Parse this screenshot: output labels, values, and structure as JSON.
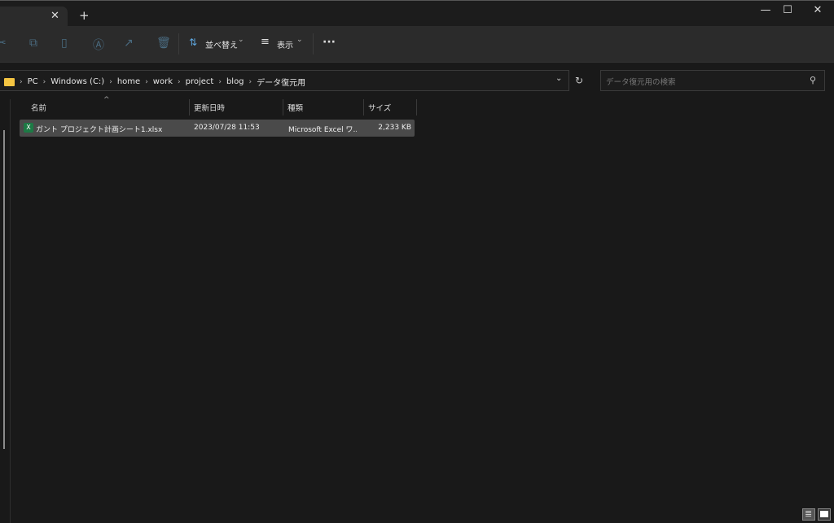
{
  "tabs": {
    "close": "✕",
    "new": "+"
  },
  "window": {
    "minimize": "—",
    "maximize": "☐",
    "close": "✕"
  },
  "toolbar": {
    "sort_label": "並べ替え",
    "view_label": "表示",
    "more": "···",
    "chevron": "⌄"
  },
  "address": {
    "crumbs": [
      "PC",
      "Windows (C:)",
      "home",
      "work",
      "project",
      "blog",
      "データ復元用"
    ]
  },
  "search": {
    "placeholder": "データ復元用の検索"
  },
  "columns": {
    "name": "名前",
    "modified": "更新日時",
    "type": "種類",
    "size": "サイズ"
  },
  "files": [
    {
      "name": "ガント プロジェクト計画シート1.xlsx",
      "modified": "2023/07/28 11:53",
      "type": "Microsoft Excel ワ...",
      "size": "2,233 KB"
    }
  ]
}
